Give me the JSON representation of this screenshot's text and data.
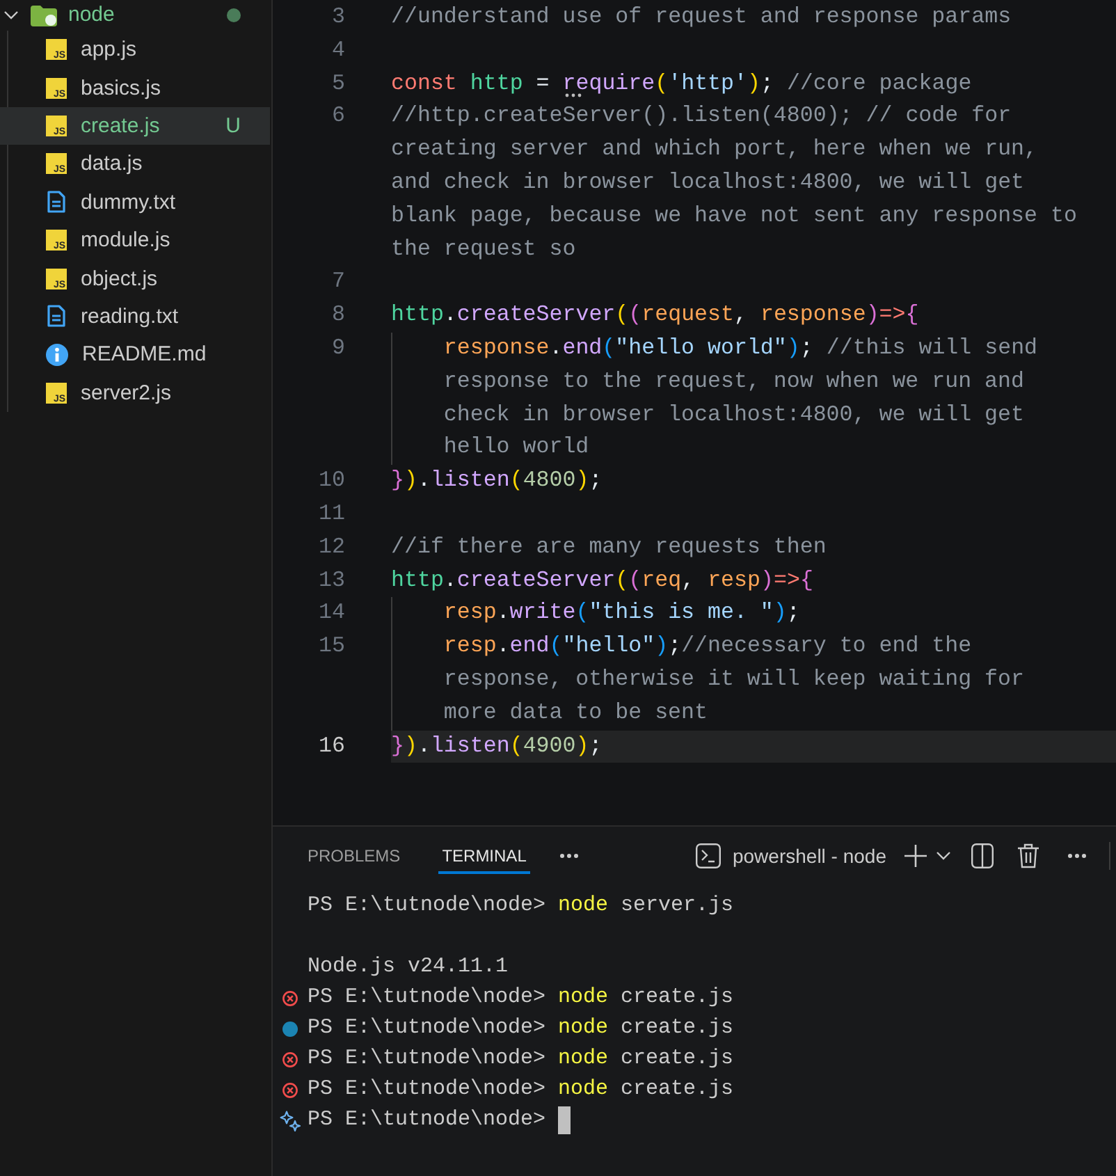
{
  "explorer": {
    "folder": {
      "name": "node",
      "expanded": true,
      "has_changes": true
    },
    "files": [
      {
        "name": "app.js",
        "kind": "js",
        "icon_text": "JS",
        "selected": false
      },
      {
        "name": "basics.js",
        "kind": "js",
        "icon_text": "JS",
        "selected": false
      },
      {
        "name": "create.js",
        "kind": "js",
        "icon_text": "JS",
        "selected": true,
        "badge": "U"
      },
      {
        "name": "data.js",
        "kind": "js",
        "icon_text": "JS",
        "selected": false
      },
      {
        "name": "dummy.txt",
        "kind": "document",
        "selected": false
      },
      {
        "name": "module.js",
        "kind": "js",
        "icon_text": "JS",
        "selected": false
      },
      {
        "name": "object.js",
        "kind": "js",
        "icon_text": "JS",
        "selected": false
      },
      {
        "name": "reading.txt",
        "kind": "document",
        "selected": false
      },
      {
        "name": "README.md",
        "kind": "info",
        "selected": false
      },
      {
        "name": "server2.js",
        "kind": "js",
        "icon_text": "JS",
        "selected": false
      }
    ]
  },
  "editor": {
    "lines": [
      {
        "number": "3",
        "current": false,
        "indented": false,
        "rows": [
          [
            {
              "kind": "comment",
              "text": "//understand use of request and response params"
            }
          ]
        ]
      },
      {
        "number": "4",
        "current": false,
        "indented": false
      },
      {
        "number": "5",
        "current": false,
        "indented": false,
        "rows": [
          [
            {
              "kind": "keyword",
              "text": "const "
            },
            {
              "kind": "variable",
              "text": "http"
            },
            {
              "kind": "punctuation",
              "text": " = "
            },
            {
              "kind": "function",
              "text": "require",
              "hint": true
            },
            {
              "kind": "bracket1",
              "text": "("
            },
            {
              "kind": "string",
              "text": "'http'"
            },
            {
              "kind": "bracket1",
              "text": ")"
            },
            {
              "kind": "punctuation",
              "text": "; "
            },
            {
              "kind": "comment",
              "text": "//core package"
            }
          ]
        ]
      },
      {
        "number": "6",
        "current": false,
        "indented": false,
        "rows": [
          [
            {
              "kind": "comment",
              "text": "//http.createServer().listen(4800); // code for"
            }
          ],
          [
            {
              "kind": "comment",
              "text": "creating server and which port, here when we run,"
            }
          ],
          [
            {
              "kind": "comment",
              "text": "and check in browser localhost:4800, we will get"
            }
          ],
          [
            {
              "kind": "comment",
              "text": "blank page, because we have not sent any response to"
            }
          ],
          [
            {
              "kind": "comment",
              "text": "the request so"
            }
          ]
        ]
      },
      {
        "number": "7",
        "current": false,
        "indented": false
      },
      {
        "number": "8",
        "current": false,
        "indented": false,
        "rows": [
          [
            {
              "kind": "variable",
              "text": "http"
            },
            {
              "kind": "punctuation",
              "text": "."
            },
            {
              "kind": "function",
              "text": "createServer"
            },
            {
              "kind": "bracket1",
              "text": "("
            },
            {
              "kind": "bracket2",
              "text": "("
            },
            {
              "kind": "parameter",
              "text": "request"
            },
            {
              "kind": "punctuation",
              "text": ", "
            },
            {
              "kind": "parameter",
              "text": "response"
            },
            {
              "kind": "bracket2",
              "text": ")"
            },
            {
              "kind": "keyword",
              "text": "=>"
            },
            {
              "kind": "bracket2",
              "text": "{"
            }
          ]
        ]
      },
      {
        "number": "9",
        "current": false,
        "indented": true,
        "rows": [
          [
            {
              "kind": "parameter",
              "text": "response"
            },
            {
              "kind": "punctuation",
              "text": "."
            },
            {
              "kind": "function",
              "text": "end"
            },
            {
              "kind": "bracket3",
              "text": "("
            },
            {
              "kind": "string",
              "text": "\"hello world\""
            },
            {
              "kind": "bracket3",
              "text": ")"
            },
            {
              "kind": "punctuation",
              "text": "; "
            },
            {
              "kind": "comment",
              "text": "//this will send"
            }
          ],
          [
            {
              "kind": "comment",
              "text": "response to the request, now when we run and"
            }
          ],
          [
            {
              "kind": "comment",
              "text": "check in browser localhost:4800, we will get"
            }
          ],
          [
            {
              "kind": "comment",
              "text": "hello world"
            }
          ]
        ]
      },
      {
        "number": "10",
        "current": false,
        "indented": false,
        "rows": [
          [
            {
              "kind": "bracket2",
              "text": "}"
            },
            {
              "kind": "bracket1",
              "text": ")"
            },
            {
              "kind": "punctuation",
              "text": "."
            },
            {
              "kind": "function",
              "text": "listen"
            },
            {
              "kind": "bracket1",
              "text": "("
            },
            {
              "kind": "number",
              "text": "4800"
            },
            {
              "kind": "bracket1",
              "text": ")"
            },
            {
              "kind": "punctuation",
              "text": ";"
            }
          ]
        ]
      },
      {
        "number": "11",
        "current": false,
        "indented": false
      },
      {
        "number": "12",
        "current": false,
        "indented": false,
        "rows": [
          [
            {
              "kind": "comment",
              "text": "//if there are many requests then"
            }
          ]
        ]
      },
      {
        "number": "13",
        "current": false,
        "indented": false,
        "rows": [
          [
            {
              "kind": "variable",
              "text": "http"
            },
            {
              "kind": "punctuation",
              "text": "."
            },
            {
              "kind": "function",
              "text": "createServer"
            },
            {
              "kind": "bracket1",
              "text": "("
            },
            {
              "kind": "bracket2",
              "text": "("
            },
            {
              "kind": "parameter",
              "text": "req"
            },
            {
              "kind": "punctuation",
              "text": ", "
            },
            {
              "kind": "parameter",
              "text": "resp"
            },
            {
              "kind": "bracket2",
              "text": ")"
            },
            {
              "kind": "keyword",
              "text": "=>"
            },
            {
              "kind": "bracket2",
              "text": "{"
            }
          ]
        ]
      },
      {
        "number": "14",
        "current": false,
        "indented": true,
        "rows": [
          [
            {
              "kind": "parameter",
              "text": "resp"
            },
            {
              "kind": "punctuation",
              "text": "."
            },
            {
              "kind": "function",
              "text": "write"
            },
            {
              "kind": "bracket3",
              "text": "("
            },
            {
              "kind": "string",
              "text": "\"this is me. \""
            },
            {
              "kind": "bracket3",
              "text": ")"
            },
            {
              "kind": "punctuation",
              "text": ";"
            }
          ]
        ]
      },
      {
        "number": "15",
        "current": false,
        "indented": true,
        "rows": [
          [
            {
              "kind": "parameter",
              "text": "resp"
            },
            {
              "kind": "punctuation",
              "text": "."
            },
            {
              "kind": "function",
              "text": "end"
            },
            {
              "kind": "bracket3",
              "text": "("
            },
            {
              "kind": "string",
              "text": "\"hello\""
            },
            {
              "kind": "bracket3",
              "text": ")"
            },
            {
              "kind": "punctuation",
              "text": ";"
            },
            {
              "kind": "comment",
              "text": "//necessary to end the"
            }
          ],
          [
            {
              "kind": "comment",
              "text": "response, otherwise it will keep waiting for"
            }
          ],
          [
            {
              "kind": "comment",
              "text": "more data to be sent"
            }
          ]
        ]
      },
      {
        "number": "16",
        "current": true,
        "indented": false,
        "rows": [
          [
            {
              "kind": "bracket2",
              "text": "}"
            },
            {
              "kind": "bracket1",
              "text": ")"
            },
            {
              "kind": "punctuation",
              "text": "."
            },
            {
              "kind": "function",
              "text": "listen"
            },
            {
              "kind": "bracket1",
              "text": "("
            },
            {
              "kind": "number",
              "text": "4900"
            },
            {
              "kind": "bracket1",
              "text": ")"
            },
            {
              "kind": "punctuation",
              "text": ";"
            }
          ]
        ]
      }
    ]
  },
  "panel": {
    "tabs": [
      {
        "label": "PROBLEMS",
        "selected": false
      },
      {
        "label": "TERMINAL",
        "selected": true
      }
    ],
    "terminal_name": "powershell - node"
  },
  "terminal": {
    "lines": [
      {
        "kind": "command",
        "prompt": "PS E:\\tutnode\\node>",
        "command": "node",
        "args": "server.js"
      },
      {
        "kind": "blank"
      },
      {
        "kind": "output",
        "text": "Node.js v24.11.1"
      },
      {
        "kind": "command",
        "decoration": {
          "kind": "error"
        },
        "prompt": "PS E:\\tutnode\\node>",
        "command": "node",
        "args": "create.js"
      },
      {
        "kind": "command",
        "decoration": {
          "kind": "success"
        },
        "prompt": "PS E:\\tutnode\\node>",
        "command": "node",
        "args": "create.js"
      },
      {
        "kind": "command",
        "decoration": {
          "kind": "error"
        },
        "prompt": "PS E:\\tutnode\\node>",
        "command": "node",
        "args": "create.js"
      },
      {
        "kind": "command",
        "decoration": {
          "kind": "error"
        },
        "prompt": "PS E:\\tutnode\\node>",
        "command": "node",
        "args": "create.js"
      },
      {
        "kind": "prompt",
        "decoration": {
          "kind": "copilot"
        },
        "prompt": "PS E:\\tutnode\\node>",
        "cursor": true
      }
    ]
  }
}
